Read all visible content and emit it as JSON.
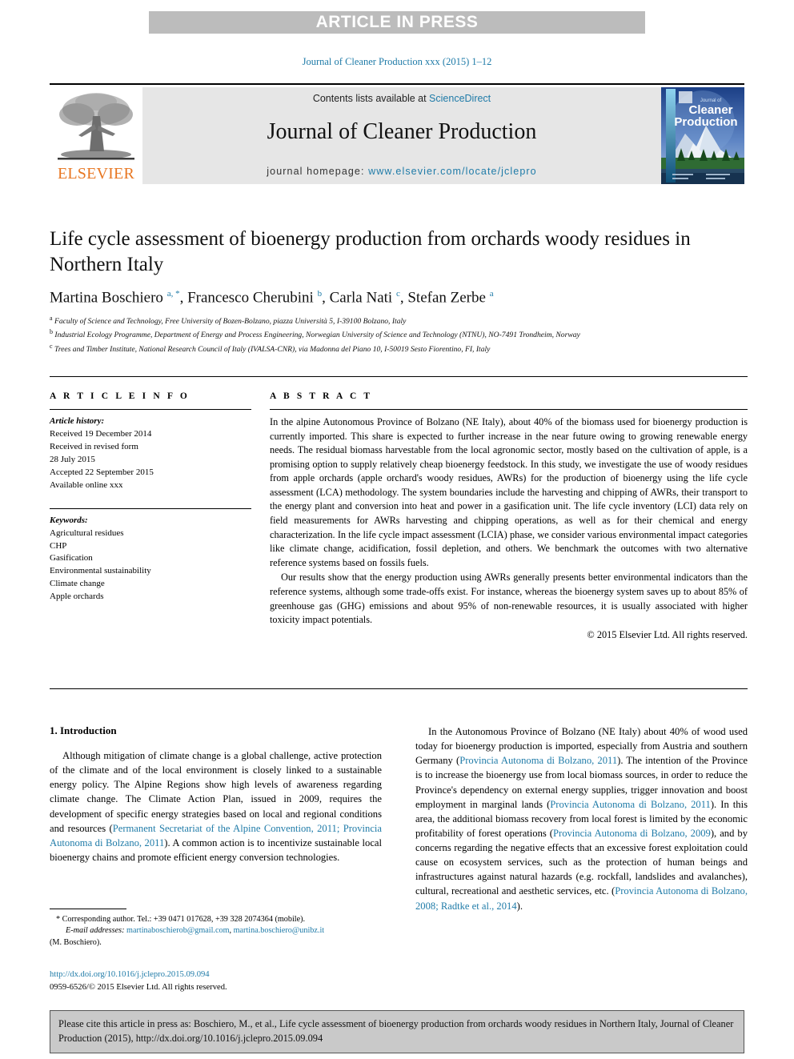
{
  "banner": {
    "text": "ARTICLE IN PRESS"
  },
  "journal_ref": "Journal of Cleaner Production xxx (2015) 1–12",
  "masthead": {
    "contents_prefix": "Contents lists available at ",
    "sciencedirect": "ScienceDirect",
    "journal_title": "Journal of Cleaner Production",
    "homepage_prefix": "journal homepage: ",
    "homepage_url": "www.elsevier.com/locate/jclepro",
    "publisher": "ELSEVIER",
    "cover": {
      "kicker": "Journal of",
      "line1": "Cleaner",
      "line2": "Production"
    },
    "accent_color": "#1f7ba8",
    "publisher_color": "#e87722",
    "panel_color": "#e6e6e6"
  },
  "article": {
    "title": "Life cycle assessment of bioenergy production from orchards woody residues in Northern Italy",
    "authors_html": "Martina Boschiero <sup>a, *</sup>, Francesco Cherubini <sup>b</sup>, Carla Nati <sup>c</sup>, Stefan Zerbe <sup>a</sup>",
    "affiliations": [
      {
        "mark": "a",
        "text": "Faculty of Science and Technology, Free University of Bozen-Bolzano, piazza Università 5, I-39100 Bolzano, Italy"
      },
      {
        "mark": "b",
        "text": "Industrial Ecology Programme, Department of Energy and Process Engineering, Norwegian University of Science and Technology (NTNU), NO-7491 Trondheim, Norway"
      },
      {
        "mark": "c",
        "text": "Trees and Timber Institute, National Research Council of Italy (IVALSA-CNR), via Madonna del Piano 10, I-50019 Sesto Fiorentino, FI, Italy"
      }
    ]
  },
  "article_info": {
    "heading": "A R T I C L E   I N F O",
    "history_label": "Article history:",
    "history": [
      "Received 19 December 2014",
      "Received in revised form",
      "28 July 2015",
      "Accepted 22 September 2015",
      "Available online xxx"
    ],
    "keywords_label": "Keywords:",
    "keywords": [
      "Agricultural residues",
      "CHP",
      "Gasification",
      "Environmental sustainability",
      "Climate change",
      "Apple orchards"
    ]
  },
  "abstract": {
    "heading": "A B S T R A C T",
    "paragraph_1": "In the alpine Autonomous Province of Bolzano (NE Italy), about 40% of the biomass used for bioenergy production is currently imported. This share is expected to further increase in the near future owing to growing renewable energy needs. The residual biomass harvestable from the local agronomic sector, mostly based on the cultivation of apple, is a promising option to supply relatively cheap bioenergy feedstock. In this study, we investigate the use of woody residues from apple orchards (apple orchard's woody residues, AWRs) for the production of bioenergy using the life cycle assessment (LCA) methodology. The system boundaries include the harvesting and chipping of AWRs, their transport to the energy plant and conversion into heat and power in a gasification unit. The life cycle inventory (LCI) data rely on field measurements for AWRs harvesting and chipping operations, as well as for their chemical and energy characterization. In the life cycle impact assessment (LCIA) phase, we consider various environmental impact categories like climate change, acidification, fossil depletion, and others. We benchmark the outcomes with two alternative reference systems based on fossils fuels.",
    "paragraph_2": "Our results show that the energy production using AWRs generally presents better environmental indicators than the reference systems, although some trade-offs exist. For instance, whereas the bioenergy system saves up to about 85% of greenhouse gas (GHG) emissions and about 95% of non-renewable resources, it is usually associated with higher toxicity impact potentials.",
    "copyright": "© 2015 Elsevier Ltd. All rights reserved."
  },
  "introduction": {
    "section_number_title": "1. Introduction",
    "left_paragraph_parts": [
      {
        "type": "text",
        "value": "Although mitigation of climate change is a global challenge, active protection of the climate and of the local environment is closely linked to a sustainable energy policy. The Alpine Regions show high levels of awareness regarding climate change. The Climate Action Plan, issued in 2009, requires the development of specific energy strategies based on local and regional conditions and resources ("
      },
      {
        "type": "cite",
        "value": "Permanent Secretariat of the Alpine Convention, 2011; Provincia Autonoma di Bolzano, 2011"
      },
      {
        "type": "text",
        "value": "). A common action is to incentivize sustainable local bioenergy chains and promote efficient energy conversion technologies."
      }
    ],
    "right_paragraph_parts": [
      {
        "type": "text",
        "value": "In the Autonomous Province of Bolzano (NE Italy) about 40% of wood used today for bioenergy production is imported, especially from Austria and southern Germany ("
      },
      {
        "type": "cite",
        "value": "Provincia Autonoma di Bolzano, 2011"
      },
      {
        "type": "text",
        "value": "). The intention of the Province is to increase the bioenergy use from local biomass sources, in order to reduce the Province's dependency on external energy supplies, trigger innovation and boost employment in marginal lands ("
      },
      {
        "type": "cite",
        "value": "Provincia Autonoma di Bolzano, 2011"
      },
      {
        "type": "text",
        "value": "). In this area, the additional biomass recovery from local forest is limited by the economic profitability of forest operations ("
      },
      {
        "type": "cite",
        "value": "Provincia Autonoma di Bolzano, 2009"
      },
      {
        "type": "text",
        "value": "), and by concerns regarding the negative effects that an excessive forest exploitation could cause on ecosystem services, such as the protection of human beings and infrastructures against natural hazards (e.g. rockfall, landslides and avalanches), cultural, recreational and aesthetic services, etc. ("
      },
      {
        "type": "cite",
        "value": "Provincia Autonoma di Bolzano, 2008; Radtke et al., 2014"
      },
      {
        "type": "text",
        "value": ")."
      }
    ]
  },
  "footnote": {
    "corresponding": "Corresponding author. Tel.: +39 0471 017628, +39 328 2074364 (mobile).",
    "email_label": "E-mail addresses:",
    "email_1": "martinaboschierob@gmail.com",
    "email_2": "martina.boschiero@unibz.it",
    "email_owner": "(M. Boschiero)."
  },
  "footer": {
    "doi": "http://dx.doi.org/10.1016/j.jclepro.2015.09.094",
    "issn_line": "0959-6526/© 2015 Elsevier Ltd. All rights reserved."
  },
  "citation_box": {
    "text": "Please cite this article in press as: Boschiero, M., et al., Life cycle assessment of bioenergy production from orchards woody residues in Northern Italy, Journal of Cleaner Production (2015), http://dx.doi.org/10.1016/j.jclepro.2015.09.094"
  }
}
